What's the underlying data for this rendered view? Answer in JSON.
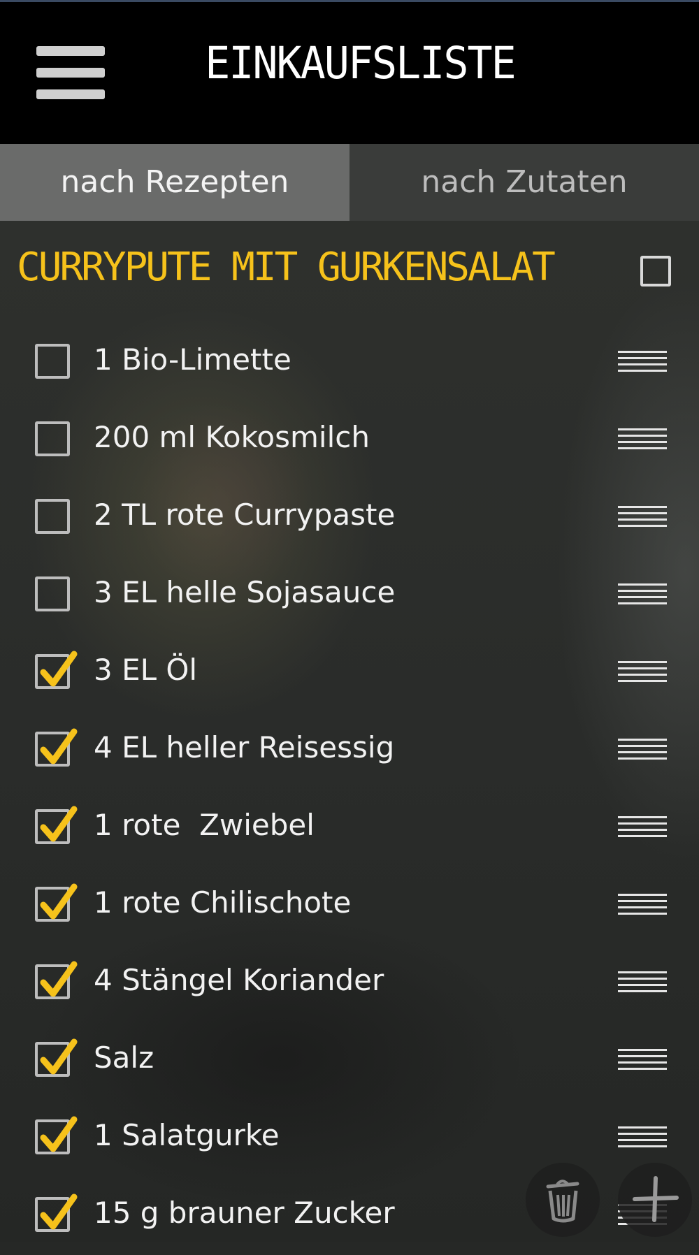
{
  "header": {
    "title": "EINKAUFSLISTE",
    "menu_icon": "hamburger-menu-icon"
  },
  "tabs": [
    {
      "label": "nach Rezepten",
      "active": true
    },
    {
      "label": "nach Zutaten",
      "active": false
    }
  ],
  "recipe": {
    "title": "CURRYPUTE MIT GURKENSALAT",
    "checked": false,
    "items": [
      {
        "label": "1 Bio-Limette",
        "checked": false
      },
      {
        "label": "200 ml Kokosmilch",
        "checked": false
      },
      {
        "label": "2 TL rote Currypaste",
        "checked": false
      },
      {
        "label": "3 EL helle Sojasauce",
        "checked": false
      },
      {
        "label": "3 EL Öl",
        "checked": true
      },
      {
        "label": "4 EL heller Reisessig",
        "checked": true
      },
      {
        "label": "1 rote  Zwiebel",
        "checked": true
      },
      {
        "label": "1 rote Chilischote",
        "checked": true
      },
      {
        "label": "4 Stängel Koriander",
        "checked": true
      },
      {
        "label": "Salz",
        "checked": true
      },
      {
        "label": "1 Salatgurke",
        "checked": true
      },
      {
        "label": "15 g brauner Zucker",
        "checked": true
      }
    ]
  },
  "actions": {
    "delete_icon": "trash-icon",
    "add_icon": "plus-icon"
  },
  "colors": {
    "accent": "#f6c21b",
    "header_bg": "#000000",
    "tab_active": "#6a6b6a",
    "tab_inactive": "#3a3c3a"
  }
}
